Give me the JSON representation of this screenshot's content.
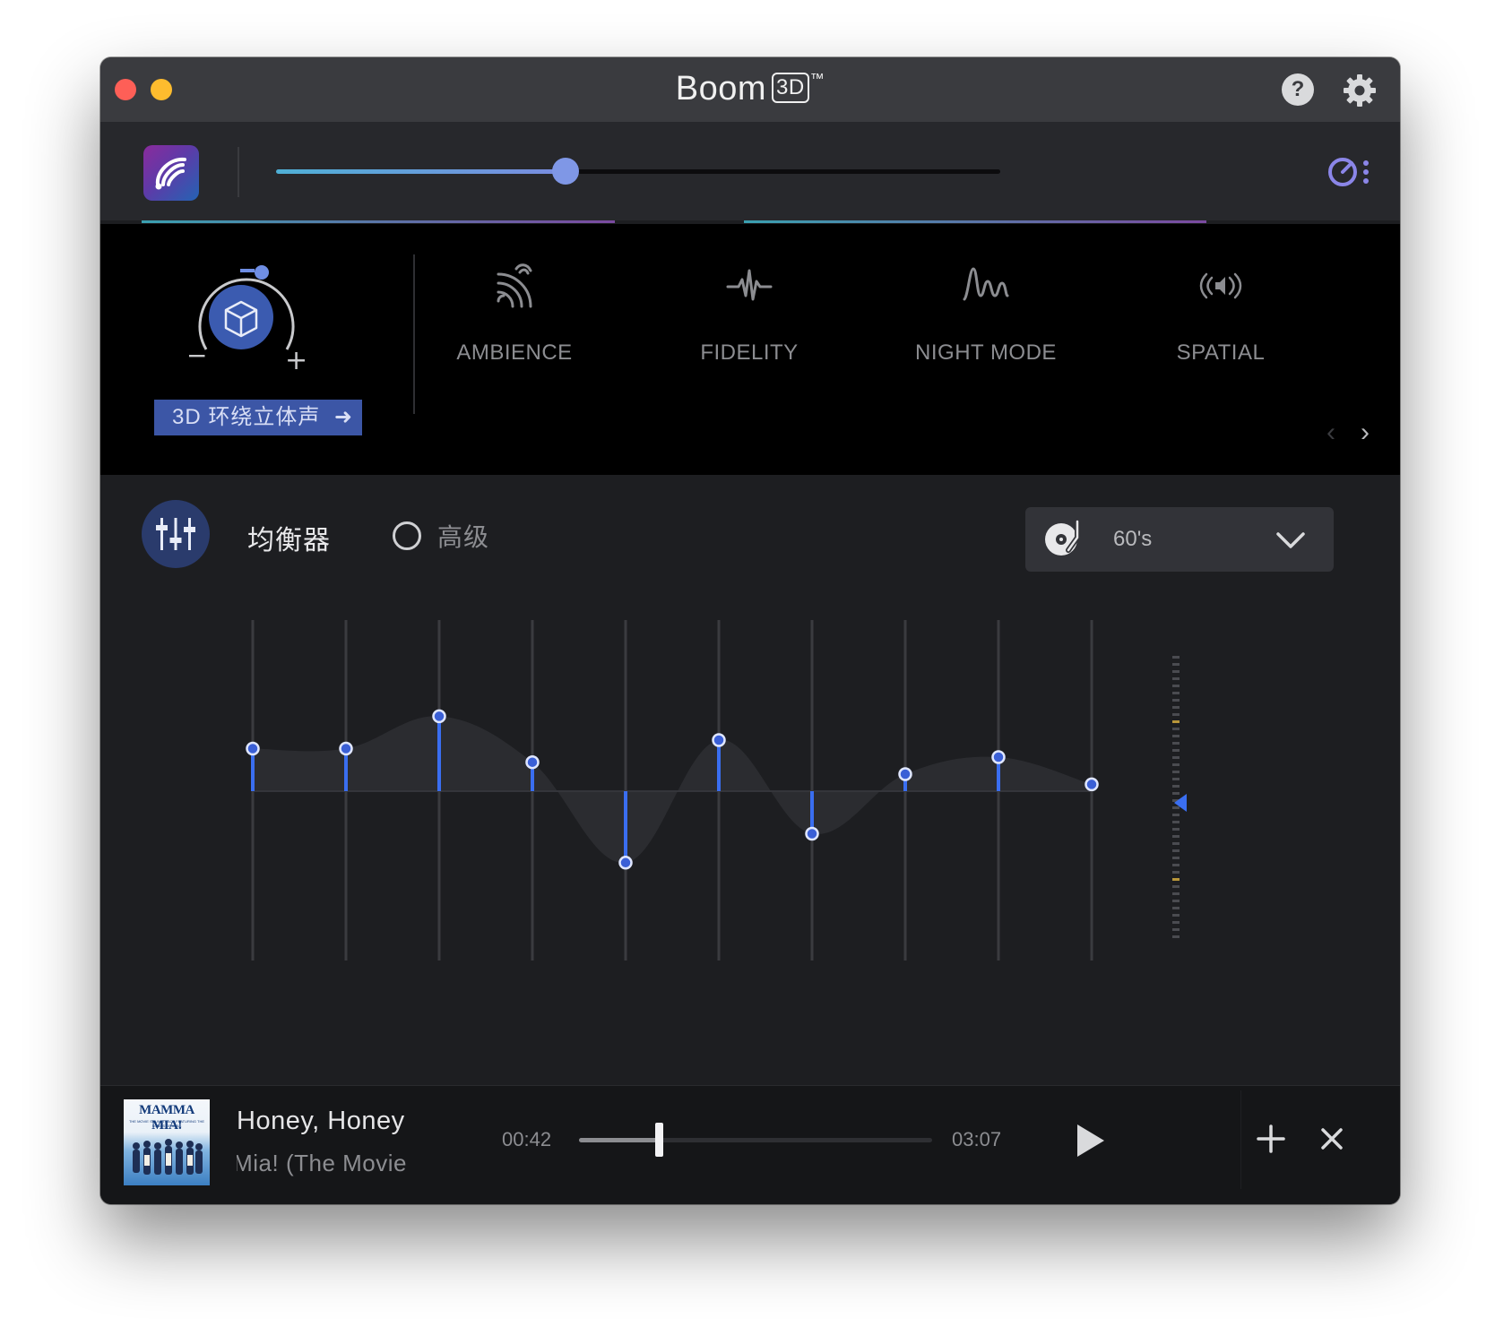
{
  "window": {
    "title": "Boom",
    "title_badge": "3D",
    "title_tm": "™"
  },
  "header": {
    "help_label": "?"
  },
  "volume": {
    "level": 0.4
  },
  "effects": {
    "surround_label": "3D 环绕立体声",
    "surround_arrow": "➜",
    "items": [
      {
        "label": "AMBIENCE",
        "icon": "ambience-icon"
      },
      {
        "label": "FIDELITY",
        "icon": "fidelity-icon"
      },
      {
        "label": "NIGHT MODE",
        "icon": "night-mode-icon"
      },
      {
        "label": "SPATIAL",
        "icon": "spatial-icon"
      }
    ],
    "nav_prev": "‹",
    "nav_next": "›"
  },
  "equalizer": {
    "title": "均衡器",
    "advanced_label": "高级",
    "preset": "60's",
    "band_levels": [
      0.25,
      0.25,
      0.44,
      0.17,
      -0.42,
      0.3,
      -0.25,
      0.1,
      0.2,
      0.04
    ],
    "colors": {
      "bar": "#3a6ef0",
      "knob": "#3a5fd6"
    }
  },
  "player": {
    "song_title": "Honey, Honey",
    "song_subtitle": "Mamma Mia! (The Movie",
    "album_art_text": "MAMMA MIA!",
    "album_art_subtext": "THE MOVIE SOUNDTRACK FEATURING THE SONGS OF ABBA",
    "current_time": "00:42",
    "total_time": "03:07",
    "progress": 0.225
  }
}
